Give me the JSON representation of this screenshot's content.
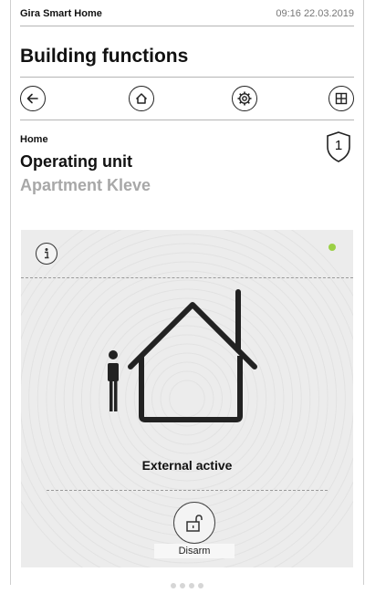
{
  "statusbar": {
    "app_name": "Gira Smart Home",
    "datetime": "09:16 22.03.2019"
  },
  "header": {
    "title": "Building functions"
  },
  "nav": {
    "back_icon": "arrow-left-icon",
    "home_icon": "house-icon",
    "settings_icon": "gear-icon",
    "grid_icon": "grid-icon"
  },
  "breadcrumb": "Home",
  "device": {
    "name": "Operating unit",
    "location": "Apartment Kleve",
    "badge": "1",
    "badge_icon": "shield-icon"
  },
  "alarm": {
    "info_icon": "info-icon",
    "indicator_color": "#9bd045",
    "state": "External active",
    "disarm_label": "Disarm",
    "disarm_icon": "unlocked-padlock-icon"
  },
  "colors": {
    "accent": "#9bd045",
    "panel": "#ececec",
    "text": "#111111",
    "muted": "#a8a8a8"
  }
}
